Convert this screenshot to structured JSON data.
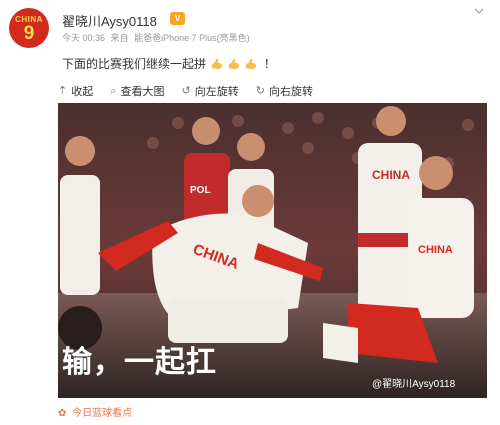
{
  "post": {
    "avatar": {
      "top_text": "CHINA",
      "number": "9"
    },
    "username": "翟晓川Aysy0118",
    "meta": {
      "time": "今天 00:36",
      "source_prefix": "来自",
      "source": "能爸爸iPhone 7 Plus(亮黑色)"
    },
    "text": "下面的比赛我们继续一起拼",
    "text_suffix": "！",
    "emoji": "strong-arm-icon",
    "actions": [
      {
        "label": "收起",
        "icon": "collapse-up-icon"
      },
      {
        "label": "查看大图",
        "icon": "search-icon"
      },
      {
        "label": "向左旋转",
        "icon": "rotate-left-icon"
      },
      {
        "label": "向右旋转",
        "icon": "rotate-right-icon"
      }
    ],
    "image": {
      "caption": "输，一起扛",
      "watermark": "@翟晓川Aysy0118",
      "jerseys": [
        "POL",
        "CHINA",
        "CHINA",
        "CHINA"
      ]
    },
    "topic": "今日篮球看点"
  },
  "colors": {
    "accent": "#eb7350",
    "china_red": "#d22a1f",
    "caption_white": "#ffffff"
  }
}
